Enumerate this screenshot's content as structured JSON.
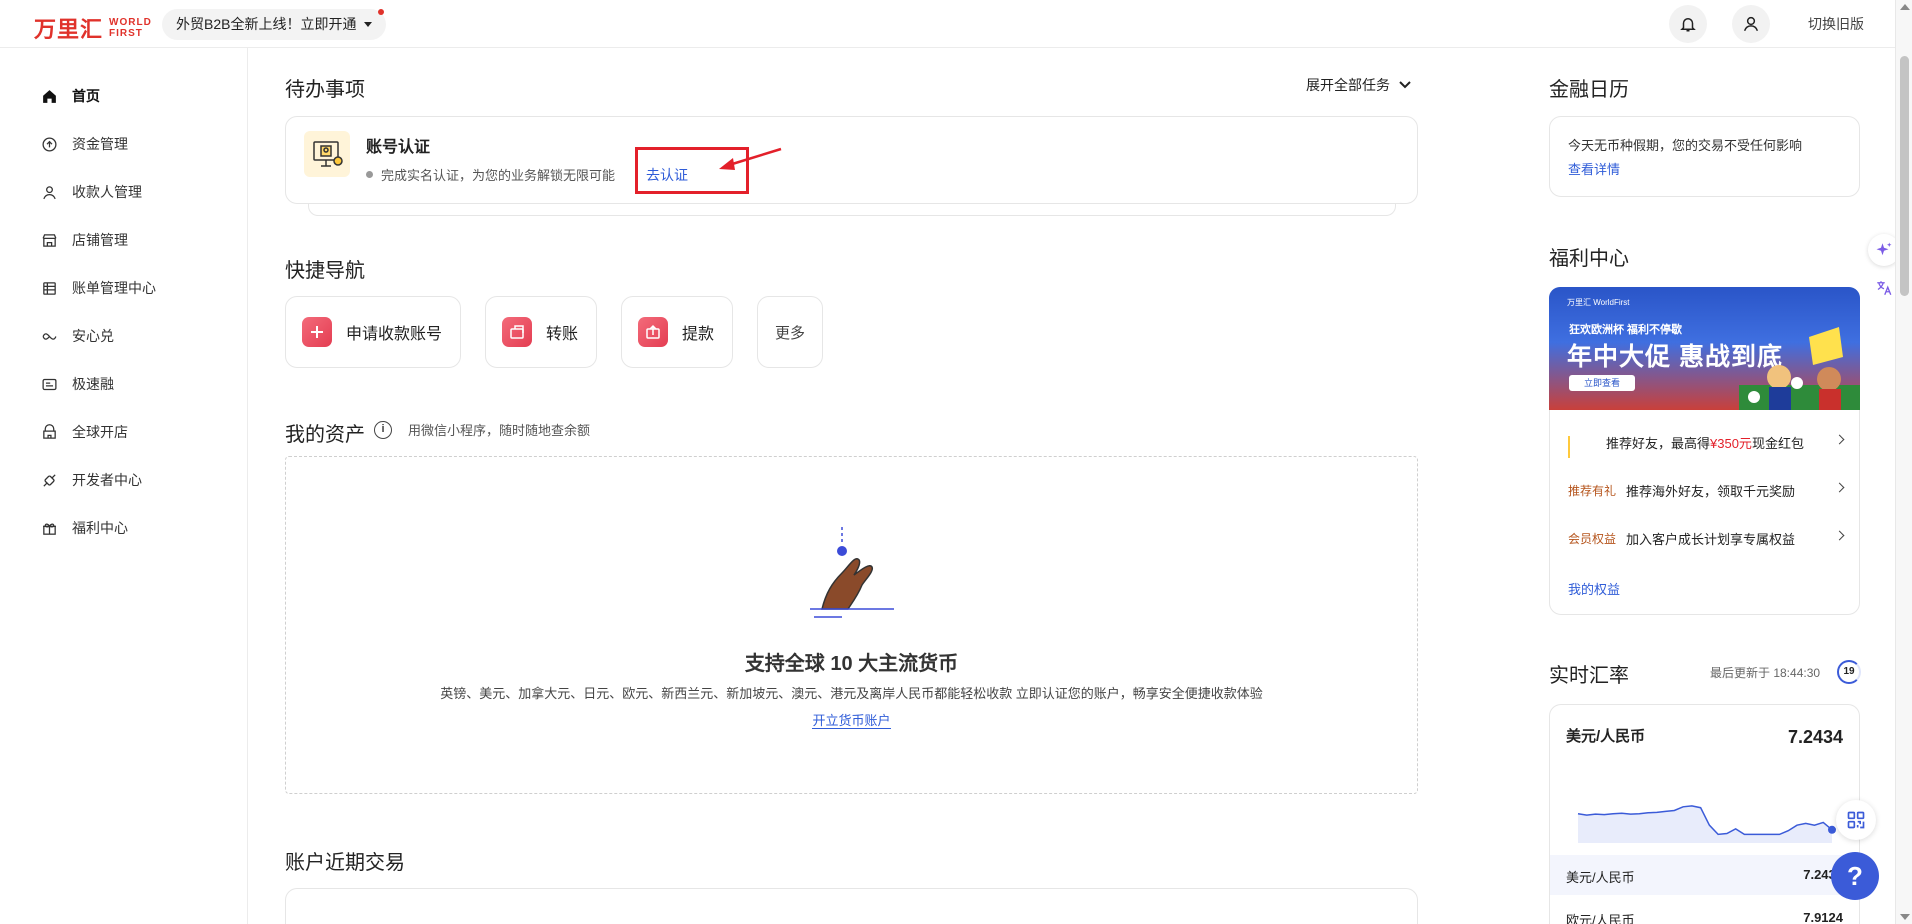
{
  "topbar": {
    "logo_cn": "万里汇",
    "logo_en_line1": "WORLD",
    "logo_en_line2": "FIRST",
    "promo": "外贸B2B全新上线！立即开通",
    "switch_old": "切换旧版"
  },
  "sidebar": {
    "items": [
      {
        "label": "首页",
        "icon": "home-icon"
      },
      {
        "label": "资金管理",
        "icon": "fund-icon"
      },
      {
        "label": "收款人管理",
        "icon": "user-icon"
      },
      {
        "label": "店铺管理",
        "icon": "store-icon"
      },
      {
        "label": "账单管理中心",
        "icon": "bill-icon"
      },
      {
        "label": "安心兑",
        "icon": "exchange-icon"
      },
      {
        "label": "极速融",
        "icon": "finance-icon"
      },
      {
        "label": "全球开店",
        "icon": "global-store-icon"
      },
      {
        "label": "开发者中心",
        "icon": "developer-icon"
      },
      {
        "label": "福利中心",
        "icon": "gift-icon"
      }
    ]
  },
  "todo": {
    "title": "待办事项",
    "expand_all": "展开全部任务",
    "item_title": "账号认证",
    "item_desc": "完成实名认证，为您的业务解锁无限可能",
    "item_link": "去认证"
  },
  "quick_nav": {
    "title": "快捷导航",
    "items": [
      "申请收款账号",
      "转账",
      "提款",
      "更多"
    ]
  },
  "assets": {
    "title": "我的资产",
    "tip": "用微信小程序，随时随地查余额",
    "headline": "支持全球 10 大主流货币",
    "desc": "英镑、美元、加拿大元、日元、欧元、新西兰元、新加坡元、澳元、港元及离岸人民币都能轻松收款 立即认证您的账户，畅享安全便捷收款体验",
    "link": "开立货币账户"
  },
  "recent": {
    "title": "账户近期交易"
  },
  "calendar": {
    "title": "金融日历",
    "text": "今天无币种假期，您的交易不受任何影响",
    "link": "查看详情"
  },
  "benefits": {
    "title": "福利中心",
    "banner_logo": "万里汇 WorldFirst",
    "banner_line1": "狂欢欧洲杯 福利不停歇",
    "banner_line2": "年中大促 惠战到底",
    "banner_btn": "立即查看",
    "row1_pre": "推荐好友，最高得",
    "row1_amt": "¥350元",
    "row1_post": "现金红包",
    "row2_tag": "推荐有礼",
    "row2_text": "推荐海外好友，领取千元奖励",
    "row3_tag": "会员权益",
    "row3_text": "加入客户成长计划享专属权益",
    "link": "我的权益"
  },
  "fx": {
    "title": "实时汇率",
    "updated": "最后更新于 18:44:30",
    "countdown": "19",
    "main_pair": "美元/人民币",
    "main_rate": "7.2434",
    "rows": [
      {
        "pair": "美元/人民币",
        "rate": "7.2434"
      },
      {
        "pair": "欧元/人民币",
        "rate": "7.9124"
      }
    ],
    "trend": [
      0.55,
      0.52,
      0.54,
      0.53,
      0.55,
      0.56,
      0.54,
      0.55,
      0.57,
      0.58,
      0.6,
      0.62,
      0.7,
      0.72,
      0.68,
      0.3,
      0.1,
      0.12,
      0.22,
      0.1,
      0.1,
      0.1,
      0.1,
      0.1,
      0.18,
      0.3,
      0.34,
      0.3,
      0.36,
      0.2
    ]
  },
  "colors": {
    "brand_red": "#e0322b",
    "link_blue": "#2f5cd8",
    "chart_blue": "#3b5bd8"
  }
}
